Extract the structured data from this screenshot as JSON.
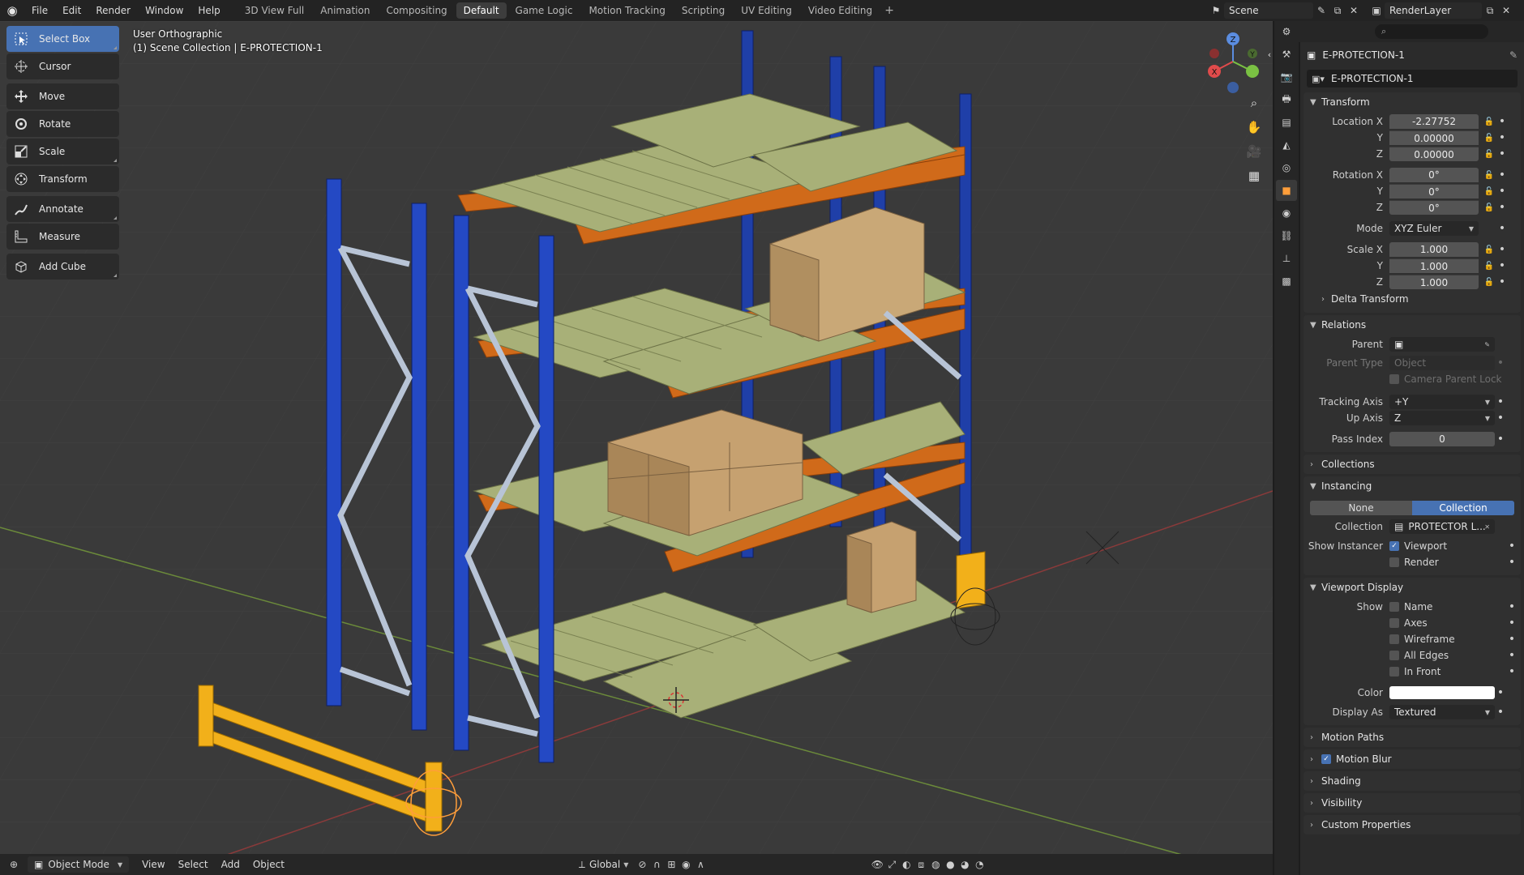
{
  "menu": [
    "File",
    "Edit",
    "Render",
    "Window",
    "Help"
  ],
  "workspaces": [
    {
      "label": "3D View Full",
      "active": false
    },
    {
      "label": "Animation",
      "active": false
    },
    {
      "label": "Compositing",
      "active": false
    },
    {
      "label": "Default",
      "active": true
    },
    {
      "label": "Game Logic",
      "active": false
    },
    {
      "label": "Motion Tracking",
      "active": false
    },
    {
      "label": "Scripting",
      "active": false
    },
    {
      "label": "UV Editing",
      "active": false
    },
    {
      "label": "Video Editing",
      "active": false
    }
  ],
  "add_tab": "+",
  "scene": {
    "name": "Scene",
    "layer": "RenderLayer"
  },
  "viewport": {
    "view_name": "User Orthographic",
    "collection_info": "(1) Scene Collection | E-PROTECTION-1"
  },
  "tools": [
    {
      "label": "Select Box",
      "icon": "select-box-icon",
      "active": true
    },
    {
      "label": "Cursor",
      "icon": "cursor-icon",
      "active": false
    },
    {
      "label": "Move",
      "icon": "move-icon",
      "active": false
    },
    {
      "label": "Rotate",
      "icon": "rotate-icon",
      "active": false
    },
    {
      "label": "Scale",
      "icon": "scale-icon",
      "active": false
    },
    {
      "label": "Transform",
      "icon": "transform-icon",
      "active": false
    },
    {
      "label": "Annotate",
      "icon": "annotate-icon",
      "active": false
    },
    {
      "label": "Measure",
      "icon": "measure-icon",
      "active": false
    },
    {
      "label": "Add Cube",
      "icon": "add-cube-icon",
      "active": false
    }
  ],
  "gizmo": {
    "x": "X",
    "y": "Y",
    "z": "Z"
  },
  "header": {
    "mode": "Object Mode",
    "menus": [
      "View",
      "Select",
      "Add",
      "Object"
    ],
    "orientation": "Global"
  },
  "properties": {
    "object_name": "E-PROTECTION-1",
    "data_name": "E-PROTECTION-1",
    "transform": {
      "title": "Transform",
      "location_label": "Location X",
      "rotation_label": "Rotation X",
      "scale_label": "Scale X",
      "y_label": "Y",
      "z_label": "Z",
      "location": [
        "-2.27752",
        "0.00000",
        "0.00000"
      ],
      "rotation": [
        "0°",
        "0°",
        "0°"
      ],
      "mode_label": "Mode",
      "mode": "XYZ Euler",
      "scale": [
        "1.000",
        "1.000",
        "1.000"
      ],
      "delta": "Delta Transform"
    },
    "relations": {
      "title": "Relations",
      "parent_label": "Parent",
      "parent_type_label": "Parent Type",
      "parent_type": "Object",
      "camera_lock": "Camera Parent Lock",
      "tracking_label": "Tracking Axis",
      "tracking": "+Y",
      "up_label": "Up Axis",
      "up": "Z",
      "pass_label": "Pass Index",
      "pass": "0"
    },
    "collections_title": "Collections",
    "instancing": {
      "title": "Instancing",
      "none": "None",
      "collection": "Collection",
      "collection_label": "Collection",
      "collection_value": "PROTECTOR L...",
      "show_label": "Show Instancer",
      "viewport": "Viewport",
      "render": "Render"
    },
    "viewport_display": {
      "title": "Viewport Display",
      "show_label": "Show",
      "name": "Name",
      "axes": "Axes",
      "wireframe": "Wireframe",
      "all_edges": "All Edges",
      "in_front": "In Front",
      "color_label": "Color",
      "color": "#ffffff",
      "display_label": "Display As",
      "display": "Textured"
    },
    "collapsed": [
      "Motion Paths",
      "Motion Blur",
      "Shading",
      "Visibility",
      "Custom Properties"
    ]
  }
}
